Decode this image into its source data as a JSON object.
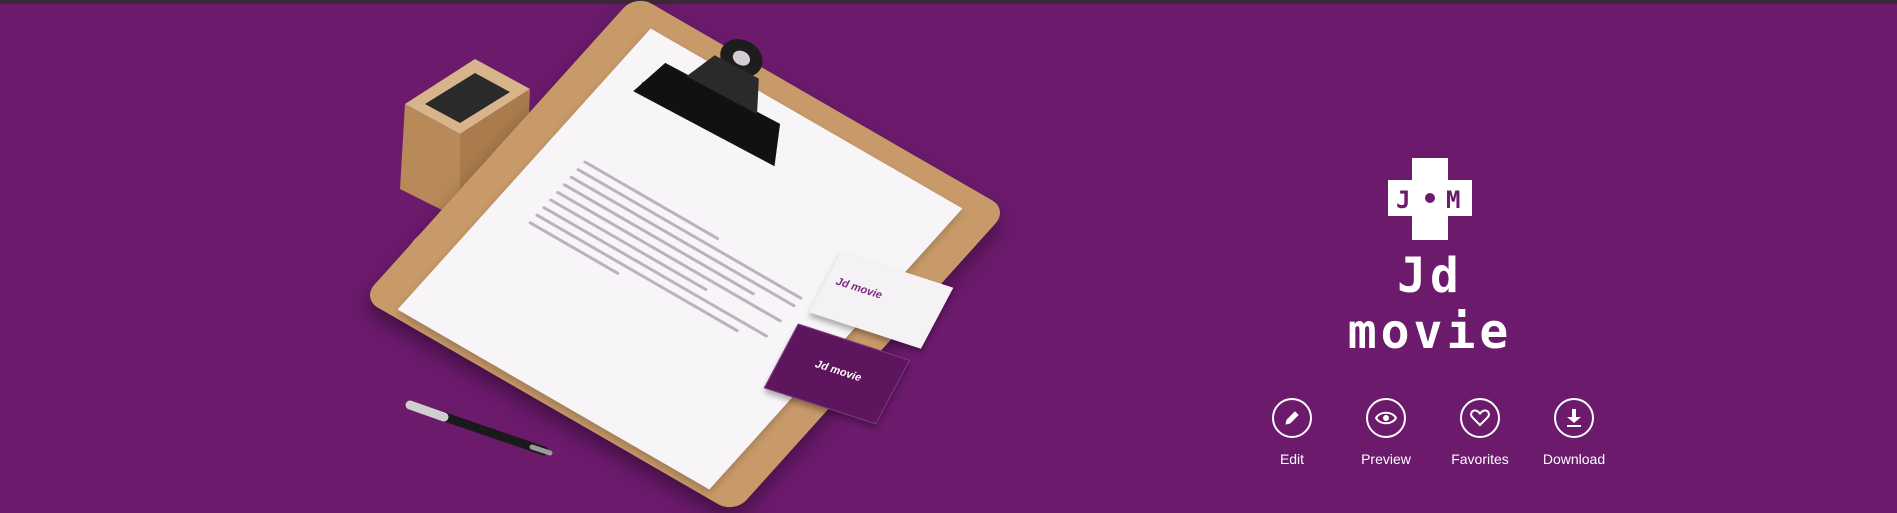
{
  "brand": {
    "name": "Jd movie",
    "monogram_letters": [
      "J",
      "M"
    ],
    "background_color": "#6b1a6c",
    "text_color": "#ffffff"
  },
  "mockup": {
    "letterhead_logo": "Jd movie",
    "card_logo": "Jd movie"
  },
  "actions": [
    {
      "label": "Edit",
      "icon": "pencil-icon"
    },
    {
      "label": "Preview",
      "icon": "eye-icon"
    },
    {
      "label": "Favorites",
      "icon": "heart-icon"
    },
    {
      "label": "Download",
      "icon": "download-icon"
    }
  ]
}
